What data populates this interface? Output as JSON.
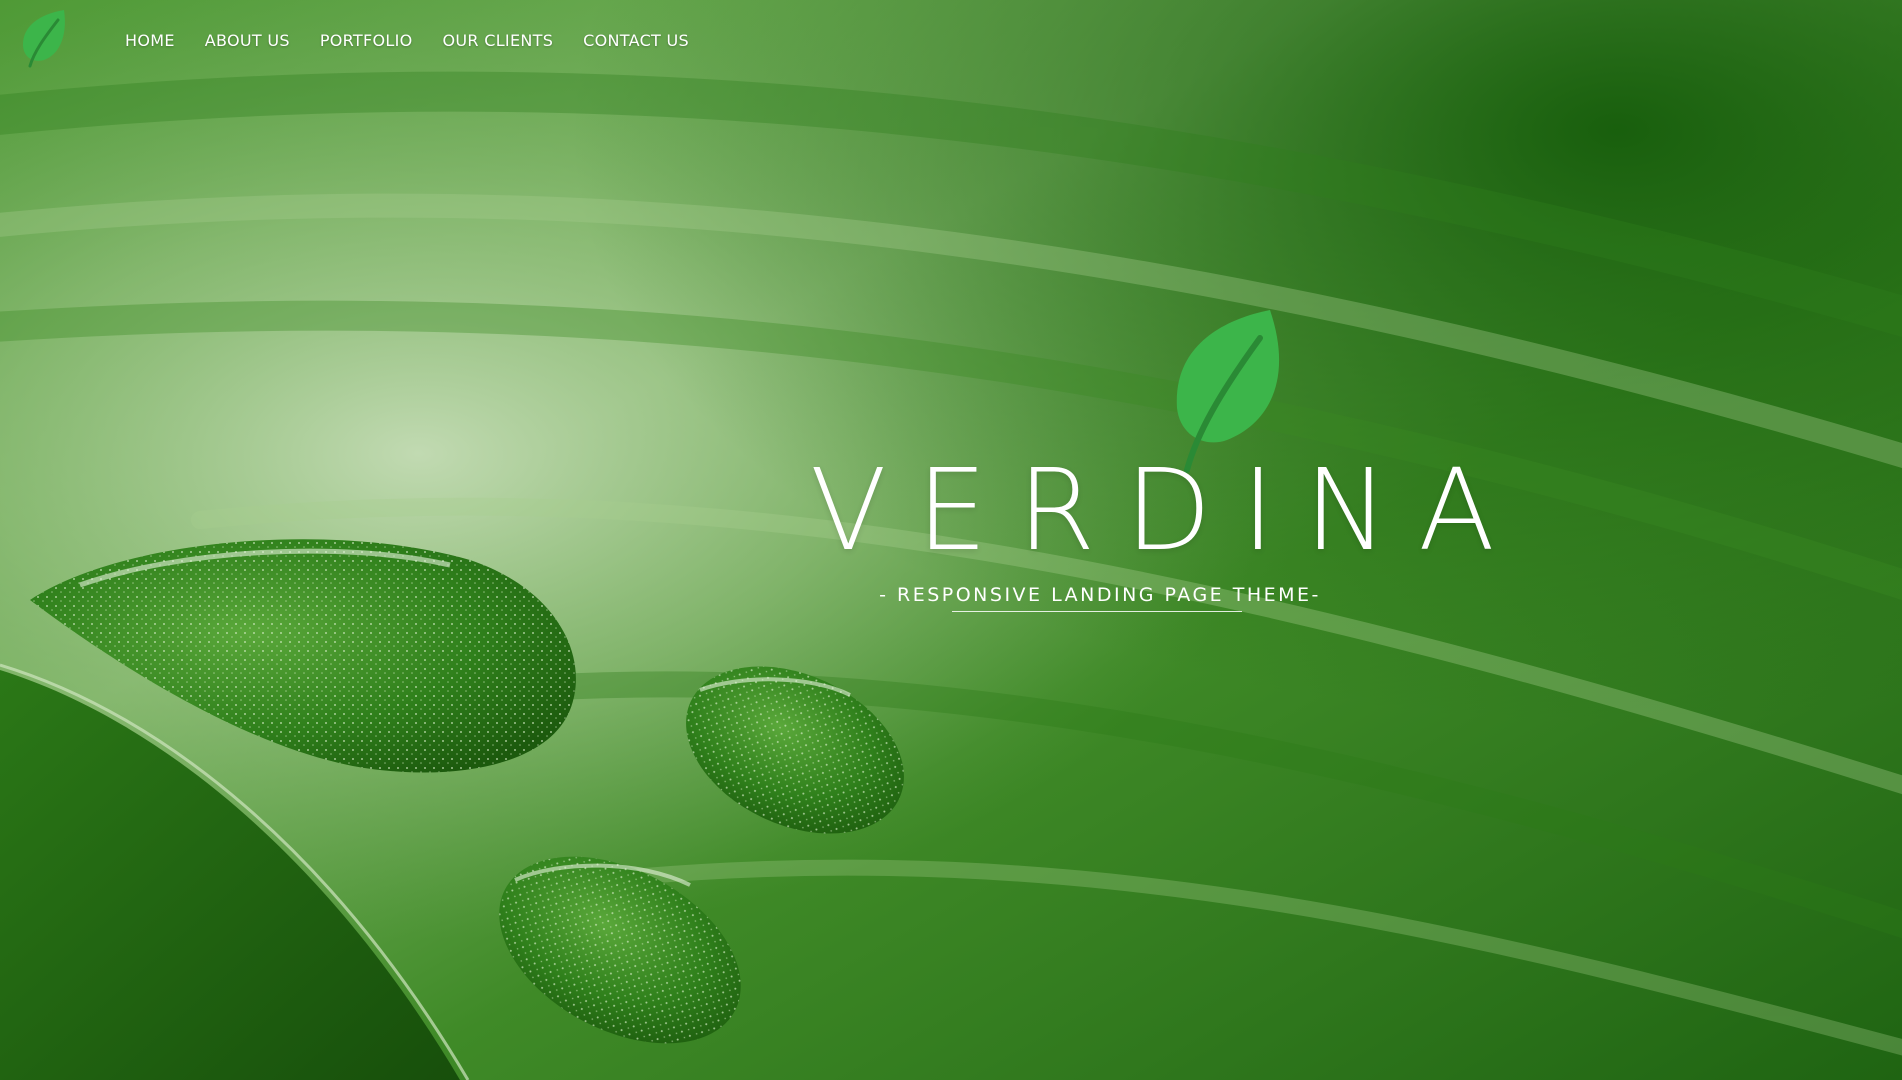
{
  "page": {
    "brand_name": "VERDINA",
    "tagline": "- RESPONSIVE LANDING PAGE THEME-"
  },
  "nav": {
    "logo_icon": "leaf-icon",
    "items": [
      {
        "label": "HOME"
      },
      {
        "label": "ABOUT US"
      },
      {
        "label": "PORTFOLIO"
      },
      {
        "label": "OUR CLIENTS"
      },
      {
        "label": "CONTACT US"
      }
    ]
  },
  "hero": {
    "icon": "leaf-icon",
    "background": "green-leaf-with-water-droplets-photo"
  },
  "colors": {
    "leaf_green": "#3cb54a",
    "leaf_vein": "#2a8a35",
    "text": "#ffffff",
    "background_dark": "#1e5a10",
    "background_light": "#9fc78a"
  }
}
